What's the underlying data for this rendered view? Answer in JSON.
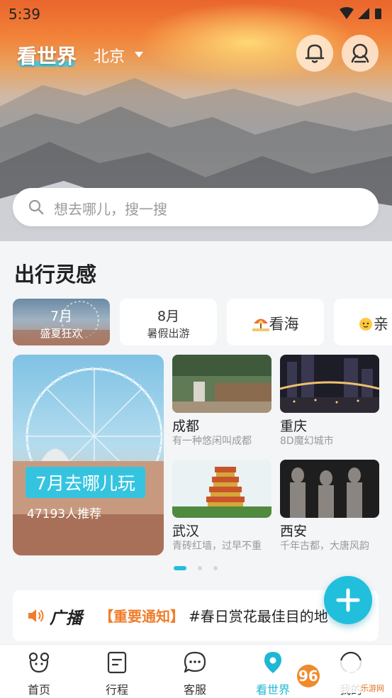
{
  "status": {
    "time": "5:39"
  },
  "header": {
    "brand": "看世界",
    "city": "北京"
  },
  "search": {
    "placeholder": "想去哪儿，搜一搜"
  },
  "inspiration": {
    "title": "出行灵感",
    "chips": [
      {
        "line1": "7月",
        "line2": "盛夏狂欢",
        "active": true
      },
      {
        "line1": "8月",
        "line2": "暑假出游"
      },
      {
        "label": "看海",
        "icon": "beach-umbrella-icon"
      },
      {
        "label": "亲",
        "icon": "baby-icon"
      }
    ],
    "feature": {
      "title": "7月去哪儿玩",
      "subtitle": "47193人推荐"
    },
    "destinations": [
      {
        "name": "成都",
        "desc": "有一种悠闲叫成都"
      },
      {
        "name": "重庆",
        "desc": "8D魔幻城市"
      },
      {
        "name": "武汉",
        "desc": "青砖红墙，过早不重"
      },
      {
        "name": "西安",
        "desc": "千年古都，大唐风韵"
      }
    ],
    "pager": {
      "current": 1,
      "total": 3
    }
  },
  "broadcast": {
    "label": "广播",
    "tag": "【重要通知】",
    "text": "#春日赏花最佳目的地"
  },
  "tabs": [
    {
      "label": "首页",
      "icon": "home-face-icon"
    },
    {
      "label": "行程",
      "icon": "itinerary-icon"
    },
    {
      "label": "客服",
      "icon": "chat-icon"
    },
    {
      "label": "看世界",
      "icon": "location-pin-icon",
      "active": true
    },
    {
      "label": "我的",
      "icon": "profile-icon"
    }
  ],
  "watermark": {
    "text": "962.NET",
    "subtext": "乐游网"
  },
  "colors": {
    "accent": "#21bfdc",
    "notice": "#f07d2b"
  }
}
